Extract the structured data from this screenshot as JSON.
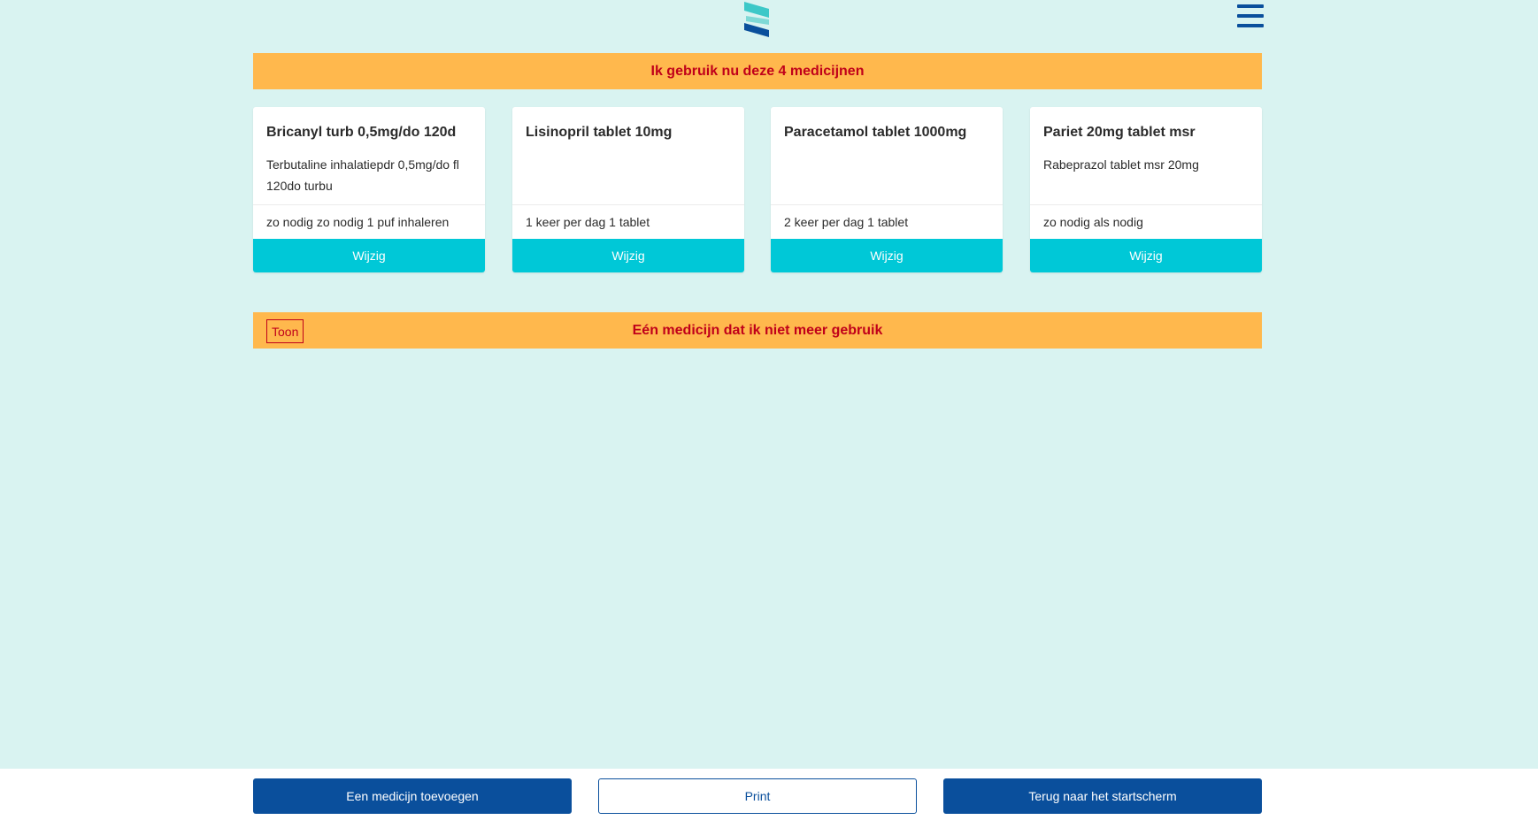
{
  "header": {
    "logo_icon": "app-logo-icon",
    "menu_icon": "hamburger-menu-icon",
    "colors": {
      "logo_light": "#3cc8c8",
      "logo_dark": "#0a4f9c"
    }
  },
  "current_section": {
    "title": "Ik gebruik nu deze 4 medicijnen"
  },
  "medicines": [
    {
      "name": "Bricanyl turb 0,5mg/do 120d",
      "description": "Terbutaline inhalatiepdr 0,5mg/do fl 120do turbu",
      "dosage": "zo nodig zo nodig 1 puf inhaleren",
      "action_label": "Wijzig"
    },
    {
      "name": "Lisinopril tablet 10mg",
      "description": "",
      "dosage": "1 keer per dag 1 tablet",
      "action_label": "Wijzig"
    },
    {
      "name": "Paracetamol tablet 1000mg",
      "description": "",
      "dosage": "2 keer per dag 1 tablet",
      "action_label": "Wijzig"
    },
    {
      "name": "Pariet 20mg tablet msr",
      "description": "Rabeprazol tablet msr 20mg",
      "dosage": "zo nodig als nodig",
      "action_label": "Wijzig"
    }
  ],
  "inactive_section": {
    "toggle_label": "Toon",
    "title": "Eén medicijn dat ik niet meer gebruik"
  },
  "footer": {
    "add_label": "Een medicijn toevoegen",
    "print_label": "Print",
    "home_label": "Terug naar het startscherm"
  },
  "colors": {
    "background": "#d9f3f1",
    "banner": "#ffb84d",
    "banner_text": "#c0001a",
    "accent": "#00c8d7",
    "primary": "#0a4f9c"
  }
}
